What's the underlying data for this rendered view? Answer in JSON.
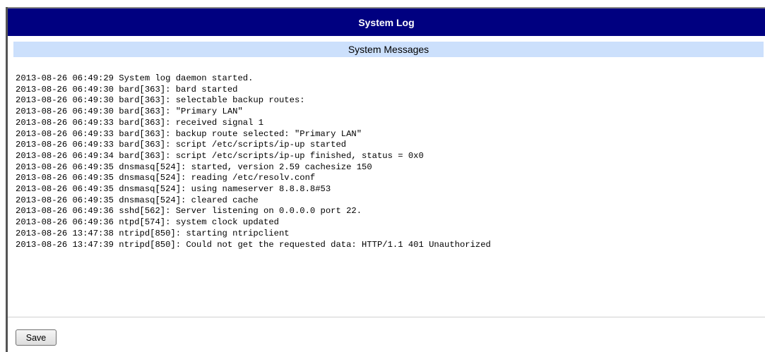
{
  "header": {
    "title": "System Log"
  },
  "section": {
    "title": "System Messages"
  },
  "log": {
    "lines": [
      "2013-08-26 06:49:29 System log daemon started.",
      "2013-08-26 06:49:30 bard[363]: bard started",
      "2013-08-26 06:49:30 bard[363]: selectable backup routes:",
      "2013-08-26 06:49:30 bard[363]: \"Primary LAN\"",
      "2013-08-26 06:49:33 bard[363]: received signal 1",
      "2013-08-26 06:49:33 bard[363]: backup route selected: \"Primary LAN\"",
      "2013-08-26 06:49:33 bard[363]: script /etc/scripts/ip-up started",
      "2013-08-26 06:49:34 bard[363]: script /etc/scripts/ip-up finished, status = 0x0",
      "2013-08-26 06:49:35 dnsmasq[524]: started, version 2.59 cachesize 150",
      "2013-08-26 06:49:35 dnsmasq[524]: reading /etc/resolv.conf",
      "2013-08-26 06:49:35 dnsmasq[524]: using nameserver 8.8.8.8#53",
      "2013-08-26 06:49:35 dnsmasq[524]: cleared cache",
      "2013-08-26 06:49:36 sshd[562]: Server listening on 0.0.0.0 port 22.",
      "2013-08-26 06:49:36 ntpd[574]: system clock updated",
      "2013-08-26 13:47:38 ntripd[850]: starting ntripclient",
      "2013-08-26 13:47:39 ntripd[850]: Could not get the requested data: HTTP/1.1 401 Unauthorized"
    ]
  },
  "actions": {
    "save_label": "Save"
  },
  "colors": {
    "title_bar": "#000080",
    "subtitle_bar": "#cce0fc"
  }
}
